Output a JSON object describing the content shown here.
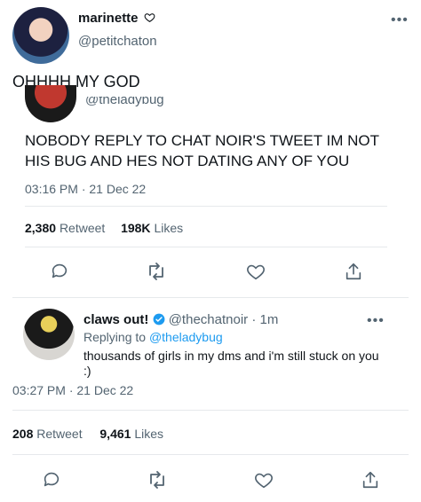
{
  "outer": {
    "name": "marinette",
    "handle": "@petitchaton",
    "text": "OHHHH MY GOD"
  },
  "quoted": {
    "handle_partial": "@theladybug",
    "text_line1": "NOBODY REPLY TO CHAT NOIR'S TWEET IM NOT",
    "text_line2": "HIS BUG AND HES NOT DATING ANY OF YOU",
    "timestamp": "03:16 PM · 21 Dec 22",
    "retweets_count": "2,380",
    "retweets_label": "Retweet",
    "likes_count": "198K",
    "likes_label": "Likes"
  },
  "reply": {
    "name": "claws out!",
    "handle": "@thechatnoir",
    "time": "· 1m",
    "replying_to_label": "Replying to",
    "replying_to_handle": "@theladybug",
    "text_line1": "thousands of girls in my dms and i'm still stuck on you",
    "text_line2": ":)",
    "timestamp": "03:27 PM · 21 Dec 22",
    "retweets_count": "208",
    "retweets_label": "Retweet",
    "likes_count": "9,461",
    "likes_label": "Likes"
  },
  "colors": {
    "accent": "#1d9bf0",
    "muted": "#536471"
  }
}
